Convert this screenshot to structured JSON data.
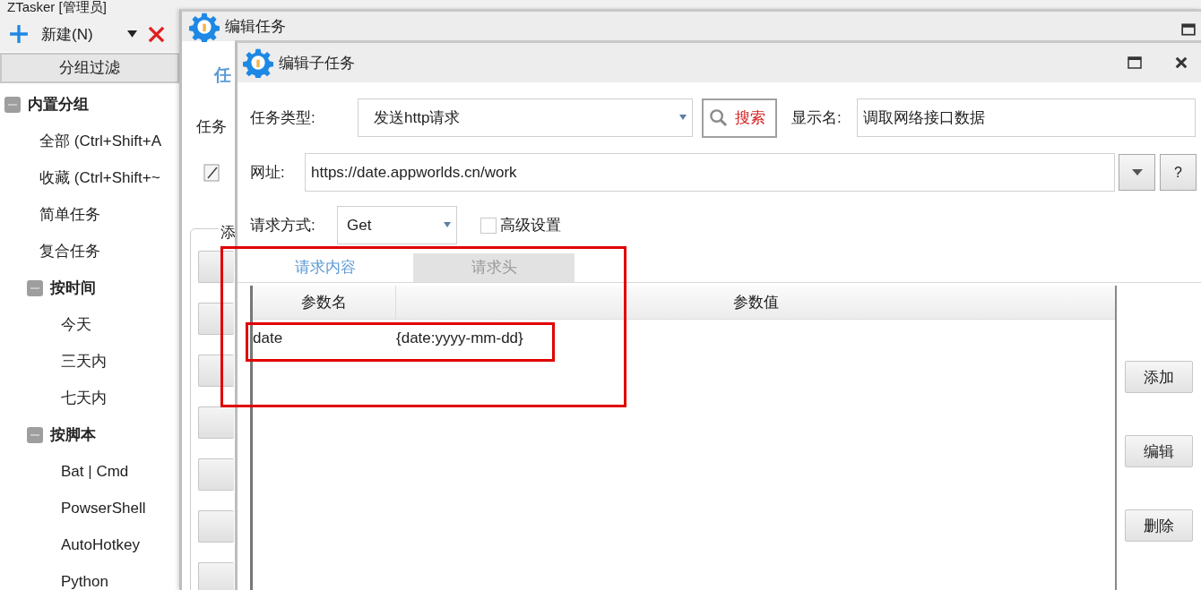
{
  "main_window": {
    "title": "ZTasker [管理员]",
    "toolbar": [
      {
        "kind": "new",
        "label": "新建(N)"
      },
      {
        "kind": "dropdown"
      },
      {
        "kind": "delete"
      }
    ],
    "filter_header": "分组过滤",
    "tree": [
      {
        "label": "内置分组",
        "expanded": true,
        "children": [
          {
            "label": "全部 (Ctrl+Shift+A"
          },
          {
            "label": "收藏 (Ctrl+Shift+~"
          },
          {
            "label": "简单任务"
          },
          {
            "label": "复合任务"
          },
          {
            "label": "按时间",
            "expanded": true,
            "children": [
              {
                "label": "今天"
              },
              {
                "label": "三天内"
              },
              {
                "label": "七天内"
              }
            ]
          },
          {
            "label": "按脚本",
            "expanded": true,
            "children": [
              {
                "label": "Bat | Cmd"
              },
              {
                "label": "PowserShell"
              },
              {
                "label": "AutoHotkey"
              },
              {
                "label": "Python"
              }
            ]
          }
        ]
      }
    ]
  },
  "task_window": {
    "title": "编辑任务",
    "tab": "任",
    "name_label": "任务",
    "group_label": "添"
  },
  "subtask_window": {
    "title": "编辑子任务",
    "task_type": {
      "label": "任务类型:",
      "value": "发送http请求"
    },
    "search_button": "搜索",
    "display_name": {
      "label": "显示名:",
      "value": "调取网络接口数据"
    },
    "url": {
      "label": "网址:",
      "value": "https://date.appworlds.cn/work"
    },
    "help_button": "?",
    "method": {
      "label": "请求方式:",
      "value": "Get"
    },
    "advanced": {
      "label": "高级设置",
      "checked": false
    },
    "tabs": [
      {
        "label": "请求内容",
        "selected": true
      },
      {
        "label": "请求头",
        "selected": false
      }
    ],
    "table": {
      "columns": [
        "参数名",
        "参数值"
      ],
      "rows": [
        [
          "date",
          "{date:yyyy-mm-dd}"
        ]
      ]
    },
    "side_buttons": [
      "添加",
      "编辑",
      "删除"
    ]
  }
}
